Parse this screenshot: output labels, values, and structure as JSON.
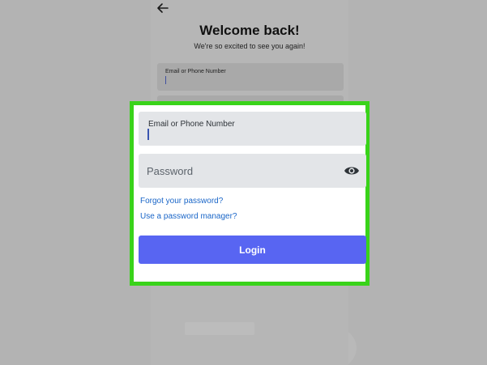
{
  "background": {
    "title": "Welcome back!",
    "subtitle": "We're so excited to see you again!",
    "email_label": "Email or Phone Number"
  },
  "login_form": {
    "email_label": "Email or Phone Number",
    "email_value": "",
    "password_placeholder": "Password",
    "forgot_password": "Forgot your password?",
    "password_manager": "Use a password manager?",
    "login_button": "Login"
  },
  "colors": {
    "highlight_border": "#39d31a",
    "button": "#5865f2",
    "link": "#1a66c8",
    "field_background": "#e3e5e8"
  },
  "icons": [
    "back-arrow-icon",
    "eye-icon"
  ]
}
